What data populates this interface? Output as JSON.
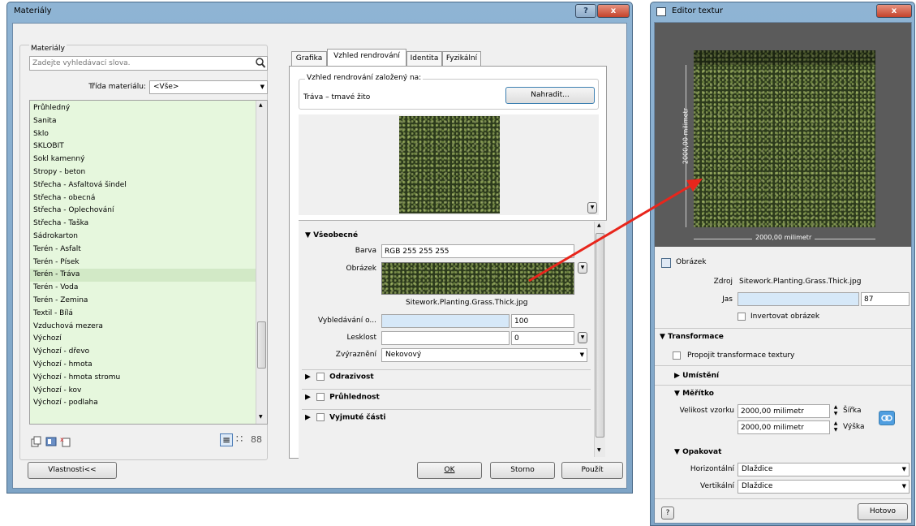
{
  "materials_dialog": {
    "title": "Materiály",
    "help_btn": "?",
    "close_btn": "x",
    "group_label": "Materiály",
    "search_placeholder": "Zadejte vyhledávací slova.",
    "class_label": "Třída materiálu:",
    "class_value": "<Vše>",
    "materials": [
      "Průhledný",
      "Sanita",
      "Sklo",
      "SKLOBIT",
      "Sokl kamenný",
      "Stropy - beton",
      "Střecha - Asfaltová šindel",
      "Střecha - obecná",
      "Střecha - Oplechování",
      "Střecha - Taška",
      "Sádrokarton",
      "Terén - Asfalt",
      "Terén - Písek",
      "Terén - Tráva",
      "Terén - Voda",
      "Terén - Zemina",
      "Textil - Bílá",
      "Vzduchová mezera",
      "Výchozí",
      "Výchozí - dřevo",
      "Výchozí - hmota",
      "Výchozí - hmota stromu",
      "Výchozí - kov",
      "Výchozí - podlaha"
    ],
    "selected_material": "Terén - Tráva",
    "tabs": [
      "Grafika",
      "Vzhled rendrování",
      "Identita",
      "Fyzikální"
    ],
    "active_tab": "Vzhled rendrování",
    "render_based_on_label": "Vzhled rendrování založený na:",
    "render_asset_name": "Tráva – tmavé žito",
    "replace_button": "Nahradit...",
    "general_section": "Všeobecné",
    "color_label": "Barva",
    "color_value": "RGB 255 255 255",
    "image_label": "Obrázek",
    "image_file": "Sitework.Planting.Grass.Thick.jpg",
    "fade_label": "Vybledávání o...",
    "fade_value": "100",
    "gloss_label": "Lesklost",
    "gloss_value": "0",
    "highlight_label": "Zvýraznění",
    "highlight_value": "Nekovový",
    "reflectivity_section": "Odrazivost",
    "transparency_section": "Průhlednost",
    "cutouts_section": "Vyjmuté části",
    "properties_button": "Vlastnosti<<",
    "ok_button": "OK",
    "cancel_button": "Storno",
    "apply_button": "Použít",
    "view_icons": [
      "≡",
      "∷",
      "88"
    ]
  },
  "texture_editor": {
    "title": "Editor textur",
    "close_btn": "x",
    "dim_vertical": "2000,00 milimetr",
    "dim_horizontal": "2000,00 milimetr",
    "image_section": "Obrázek",
    "source_label": "Zdroj",
    "source_value": "Sitework.Planting.Grass.Thick.jpg",
    "brightness_label": "Jas",
    "brightness_value": "87",
    "invert_label": "Invertovat obrázek",
    "transforms_section": "Transformace",
    "link_transforms_label": "Propojit transformace textury",
    "position_section": "Umístění",
    "scale_section": "Měřítko",
    "sample_size_label": "Velikost vzorku",
    "width_value": "2000,00 milimetr",
    "width_label": "Šířka",
    "height_value": "2000,00 milimetr",
    "height_label": "Výška",
    "repeat_section": "Opakovat",
    "horizontal_label": "Horizontální",
    "horizontal_value": "Dlaždice",
    "vertical_label": "Vertikální",
    "vertical_value": "Dlaždice",
    "help_btn": "?",
    "done_button": "Hotovo"
  },
  "colors": {
    "list_bg": "#e6f7dd",
    "arrow": "#e8261c",
    "title_blue": "#8fb4d4"
  }
}
